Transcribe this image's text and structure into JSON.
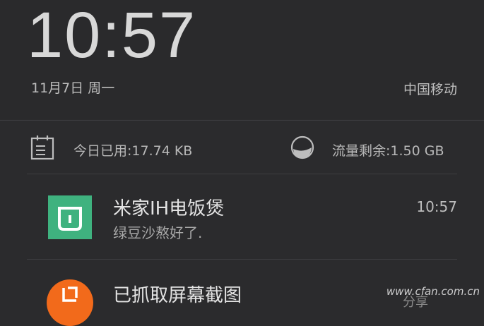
{
  "lockscreen": {
    "time": "10:57",
    "date": "11月7日  周一",
    "carrier": "中国移动"
  },
  "data_usage": {
    "today_used": "今日已用:17.74 KB",
    "remaining": "流量剩余:1.50 GB"
  },
  "notifications": [
    {
      "title": "米家IH电饭煲",
      "body": "绿豆沙熬好了.",
      "time": "10:57",
      "icon": "mijia-icon",
      "icon_color": "#3fb27f"
    },
    {
      "title": "已抓取屏幕截图",
      "action": "分享",
      "icon": "screenshot-icon",
      "icon_color": "#f26a1b"
    }
  ],
  "watermark": "www.cfan.com.cn"
}
